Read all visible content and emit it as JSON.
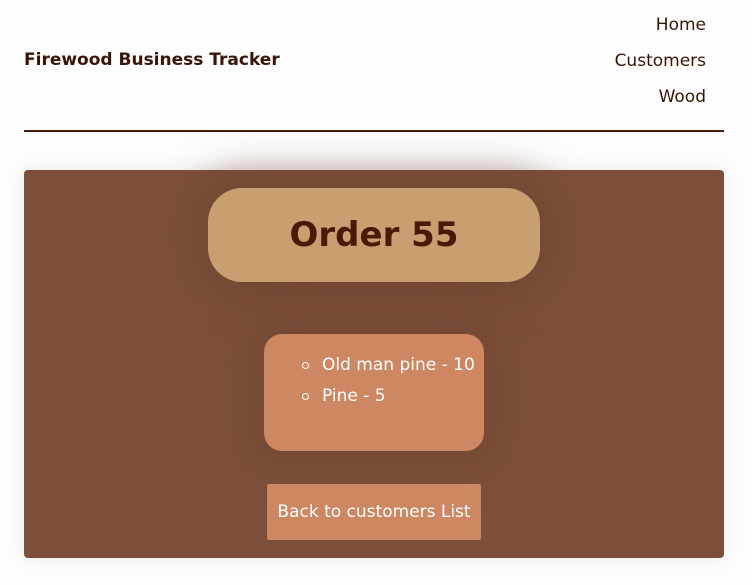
{
  "header": {
    "brand": "Firewood Business Tracker",
    "nav": [
      "Home",
      "Customers",
      "Wood"
    ]
  },
  "order": {
    "title": "Order 55",
    "items": [
      "Old man pine - 10",
      "Pine - 5"
    ],
    "back_label": "Back to customers List"
  },
  "colors": {
    "brand_text": "#3a1404",
    "panel": "#7d4f3a",
    "title_box": "#c99f72",
    "items_box": "#cd8762",
    "button": "#cd8762",
    "divider": "#4a1a08"
  }
}
